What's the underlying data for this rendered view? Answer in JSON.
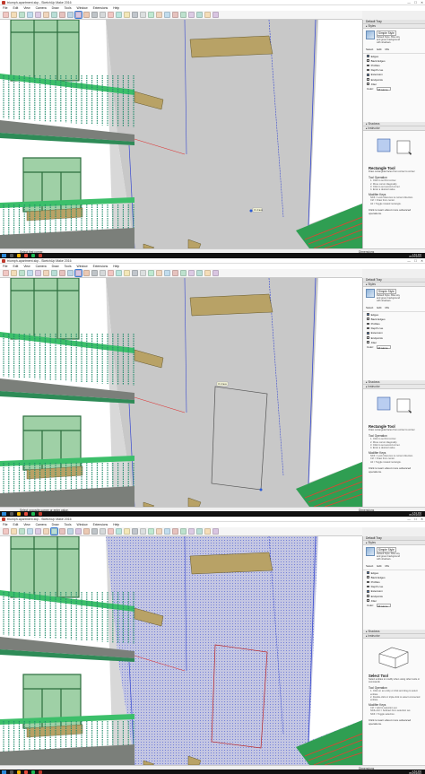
{
  "window": {
    "title": "triumph-apartment.skp - SketchUp Make 2016",
    "min": "—",
    "max": "☐",
    "close": "✕"
  },
  "menu": [
    "File",
    "Edit",
    "View",
    "Camera",
    "Draw",
    "Tools",
    "Window",
    "Extensions",
    "Help"
  ],
  "frames": [
    {
      "status": "Select first corner.",
      "measurements_label": "Dimensions",
      "clock_time": "4:53 PM",
      "clock_date": "05/25/2016",
      "tool_tip": "On Face",
      "instructor": {
        "title": "Rectangle Tool",
        "subtitle": "Draw rectangular faces from corner to corner",
        "op_heading": "Tool Operation",
        "ops": [
          "1. Click to set first corner.",
          "2. Move cursor diagonally.",
          "3. Click to set second corner.",
          "4. Enter a desired value."
        ],
        "mod_heading": "Modifier Keys",
        "mods": [
          "Shift = Lock inference to current direction.",
          "Ctrl = Draw from center.",
          "Alt = Toggle rotated rectangle."
        ],
        "link": "Click to learn about more advanced operations."
      }
    },
    {
      "status": "Select opposite corner or enter value.",
      "measurements_label": "Dimensions",
      "clock_time": "4:53 PM",
      "clock_date": "05/25/2016",
      "tool_tip": "On Face",
      "instructor": {
        "title": "Rectangle Tool",
        "subtitle": "Draw rectangular faces from corner to corner",
        "op_heading": "Tool Operation",
        "ops": [
          "1. Click to set first corner.",
          "2. Move cursor diagonally.",
          "3. Click to set second corner.",
          "4. Enter a desired value."
        ],
        "mod_heading": "Modifier Keys",
        "mods": [
          "Shift = Lock inference to current direction.",
          "Ctrl = Draw from center.",
          "Alt = Toggle rotated rectangle."
        ],
        "link": "Click to learn about more advanced operations."
      }
    },
    {
      "status": "",
      "measurements_label": "Dimensions",
      "clock_time": "4:54 PM",
      "clock_date": "05/25/2016",
      "tool_tip": "",
      "instructor": {
        "title": "Select Tool",
        "subtitle": "Select entities to modify when using other tools or commands",
        "op_heading": "Tool Operation",
        "ops": [
          "1. Click on an entity or click and drag to select entities.",
          "2. Double-click or triple-click to select connected entities."
        ],
        "mod_heading": "Modifier Keys",
        "mods": [
          "Ctrl = Add to selection set.",
          "Shift+Ctrl = Subtract from selection set.",
          "Shift = Toggle selection."
        ],
        "link": "Click to learn about more advanced operations."
      }
    }
  ],
  "tray": {
    "header": "Default Tray",
    "styles_section": "Styles",
    "style_name": "Simple Style",
    "style_desc": "Default Style. Blue sky and green background with shadows.",
    "tabs": [
      "Select",
      "Edit",
      "Mix"
    ],
    "edge_options": [
      "Edges",
      "Back Edges",
      "Profiles",
      "Depth cue",
      "Extension",
      "Endpoints",
      "Jitter"
    ],
    "edge_checked": [
      true,
      false,
      true,
      false,
      true,
      false,
      false
    ],
    "color_label": "Color:",
    "color_value": "All same",
    "shadows_section": "Shadows",
    "instructor_section": "Instructor"
  },
  "colors": {
    "wall": "#c8c8c8",
    "railing": "#2e8b57",
    "selected": "#5b6bd6",
    "accent": "#3a7bd5"
  }
}
